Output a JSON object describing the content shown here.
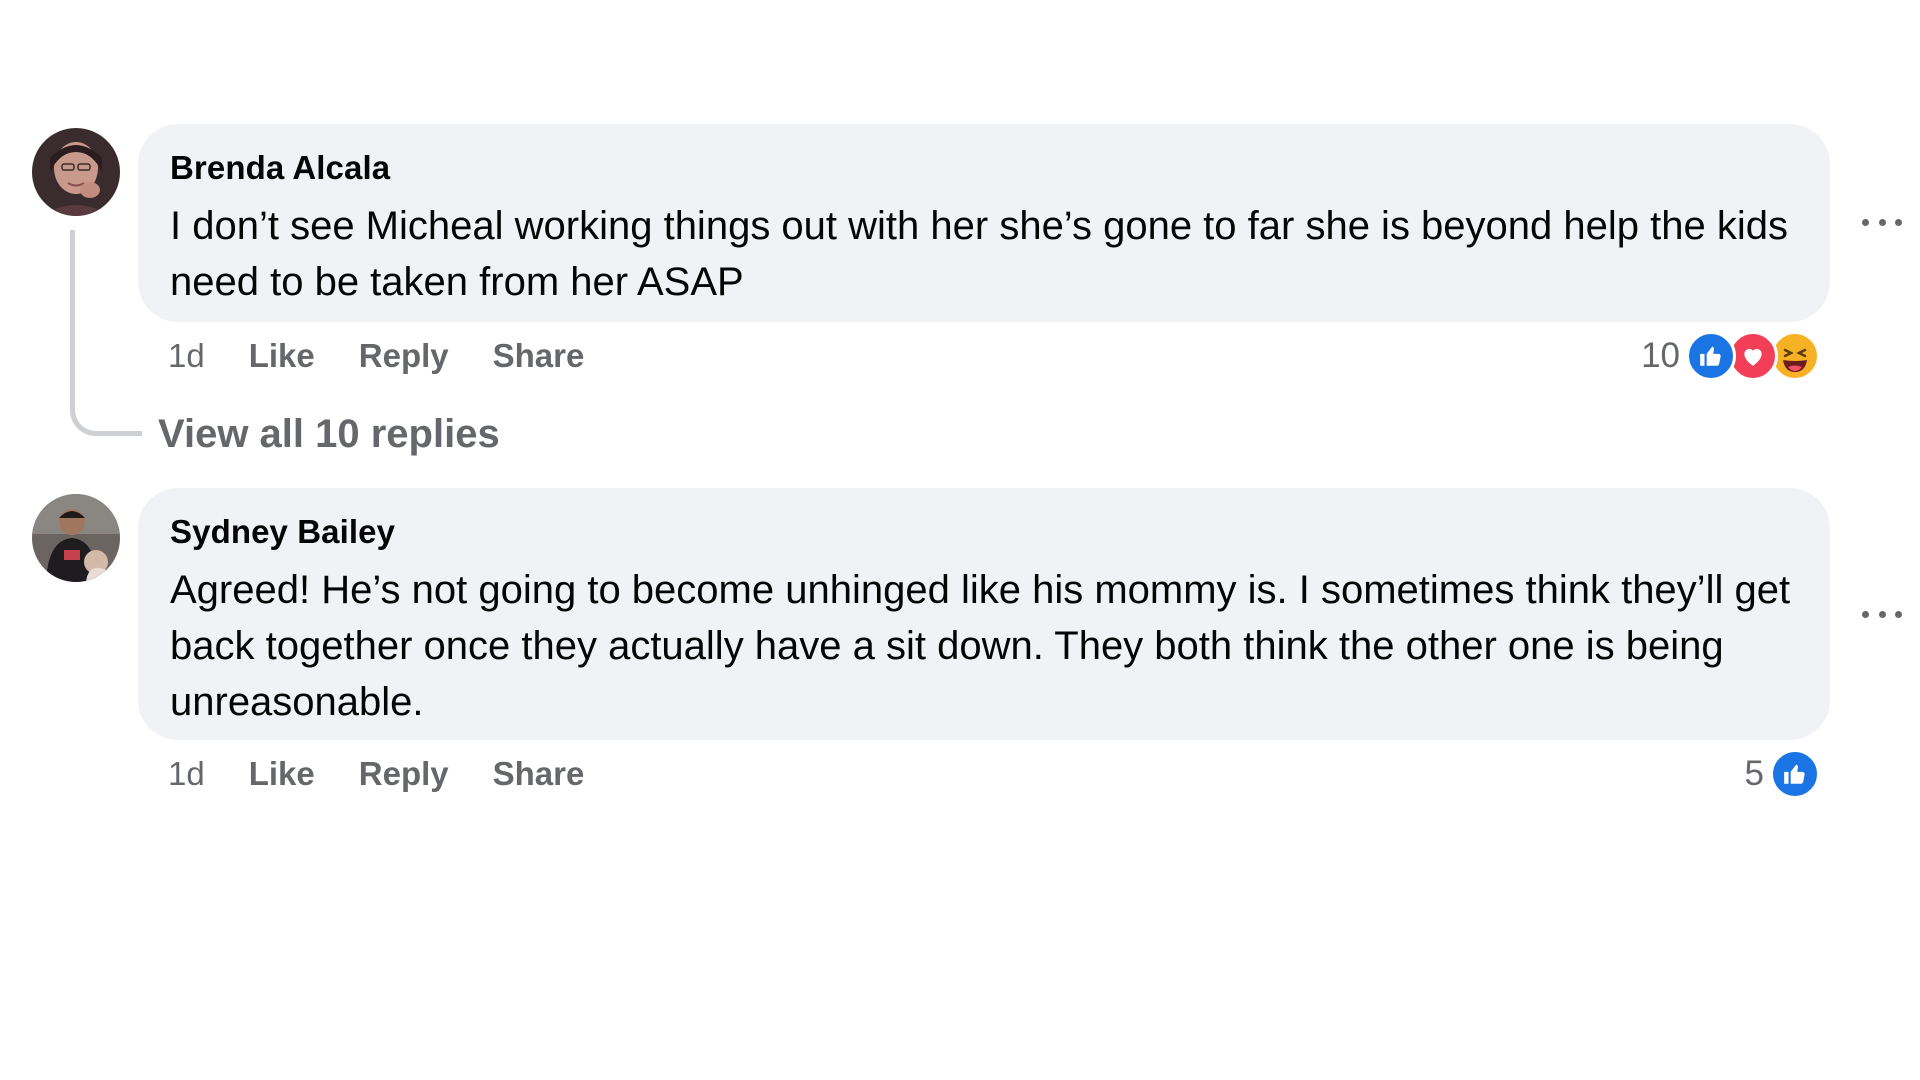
{
  "comments": [
    {
      "author": "Brenda Alcala",
      "text": "I don’t see Micheal working things out with her she’s gone to far she is beyond help the kids need to be taken from her ASAP",
      "time": "1d",
      "like_label": "Like",
      "reply_label": "Reply",
      "share_label": "Share",
      "reaction_count": "10",
      "reactions": [
        "like",
        "love",
        "haha"
      ]
    },
    {
      "author": "Sydney Bailey",
      "text": "Agreed! He’s not going to become unhinged like his mommy is. I sometimes think they’ll get back together once they actually have a sit down. They both think the other one is being unreasonable.",
      "time": "1d",
      "like_label": "Like",
      "reply_label": "Reply",
      "share_label": "Share",
      "reaction_count": "5",
      "reactions": [
        "like"
      ]
    }
  ],
  "thread": {
    "view_replies_label": "View all 10 replies"
  },
  "colors": {
    "bubble_bg": "#f0f2f5",
    "secondary_text": "#65676b",
    "like_blue": "#1b74e4",
    "love_red": "#f33e58",
    "haha_yellow": "#f7b125"
  }
}
